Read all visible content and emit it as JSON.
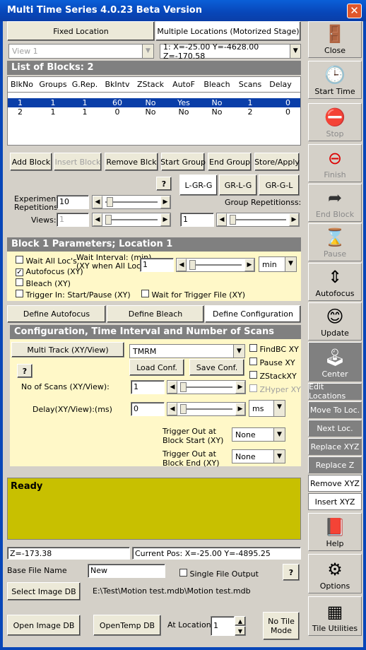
{
  "window": {
    "title": "Multi Time Series 4.0.23 Beta Version"
  },
  "location_tabs": {
    "fixed": "Fixed Location",
    "multiple": "Multiple Locations (Motorized Stage)"
  },
  "view_select": {
    "value": "View 1"
  },
  "location_select": {
    "value": "1: X=-25.00 Y=-4628.00 Z=-170.58"
  },
  "blocks": {
    "header": "List of Blocks: 2",
    "columns": [
      "BlkNo",
      "Groups",
      "G.Rep.",
      "BkIntv",
      "ZStack",
      "AutoF",
      "Bleach",
      "Scans",
      "Delay"
    ],
    "rows": [
      [
        "1",
        "1",
        "1",
        "60",
        "No",
        "Yes",
        "No",
        "1",
        "0"
      ],
      [
        "2",
        "1",
        "1",
        "0",
        "No",
        "No",
        "No",
        "2",
        "0"
      ]
    ],
    "buttons": {
      "add": "Add Block",
      "insert": "Insert Block",
      "remove": "Remove Blck",
      "start_group": "Start Group",
      "end_group": "End Group",
      "store": "Store/Apply"
    }
  },
  "repetitions": {
    "help": "?",
    "order_buttons": [
      "L-GR-G",
      "GR-L-G",
      "GR-G-L"
    ],
    "experiment_label": "Experiment\nRepetitions",
    "experiment_value": "10",
    "views_label": "Views:",
    "views_value": "1",
    "group_label": "Group Repetitionss:",
    "group_value": "1"
  },
  "block_params": {
    "header": "Block 1 Parameters; Location 1",
    "wait_all": "Wait All Loc's",
    "wait_interval_label": "Wait Interval: (min)\n(XY when All Loc)",
    "wait_interval_value": "1",
    "wait_unit": "min",
    "autofocus": "Autofocus (XY)",
    "bleach": "Bleach (XY)",
    "trigger_in": "Trigger In: Start/Pause (XY)",
    "wait_trigger": "Wait for Trigger File (XY)",
    "tabs": [
      "Define Autofocus",
      "Define Bleach",
      "Define Configuration"
    ]
  },
  "config": {
    "header": "Configuration, Time Interval and Number of Scans",
    "multi_track": "Multi Track (XY/View)",
    "config_value": "TMRM",
    "load": "Load Conf.",
    "save": "Save Conf.",
    "help": "?",
    "findbc": "FindBC XY",
    "pause": "Pause XY",
    "zstack": "ZStackXY",
    "zhyper": "ZHyper XY",
    "scans_label": "No of Scans (XY/View):",
    "scans_value": "1",
    "delay_label": "Delay(XY/View):(ms)",
    "delay_value": "0",
    "delay_unit": "ms",
    "trig_start_label": "Trigger Out at\nBlock Start (XY)",
    "trig_start_value": "None",
    "trig_end_label": "Trigger Out at\nBlock End (XY)",
    "trig_end_value": "None"
  },
  "status": {
    "text": "Ready",
    "z": "Z=-173.38",
    "pos": "Current Pos: X=-25.00 Y=-4895.25"
  },
  "files": {
    "base_label": "Base File Name",
    "base_value": "New",
    "single_output": "Single File Output",
    "help": "?",
    "select_db": "Select Image DB",
    "db_path": "E:\\Test\\Motion test.mdb\\Motion test.mdb",
    "open_db": "Open Image DB",
    "open_temp": "OpenTemp DB",
    "at_location_label": "At Location",
    "at_location_value": "1",
    "no_tile": "No Tile\nMode"
  },
  "sidebar": {
    "close": "Close",
    "start_time": "Start Time",
    "stop": "Stop",
    "finish": "Finish",
    "end_block": "End Block",
    "pause": "Pause",
    "autofocus": "Autofocus",
    "update": "Update",
    "center": "Center",
    "edit_locations": "Edit Locations",
    "move_to_loc": "Move To Loc.",
    "next_loc": "Next Loc.",
    "replace_xyz": "Replace XYZ",
    "replace_z": "Replace Z",
    "remove_xyz": "Remove XYZ",
    "insert_xyz": "Insert XYZ",
    "help": "Help",
    "options": "Options",
    "tile_utilities": "Tile Utilities"
  },
  "colors": {
    "title_blue": "#0846b8",
    "selection_blue": "#0a3ea8",
    "panel_yellow": "#fff8c8",
    "status_olive": "#c8c000",
    "dark_button": "#808080"
  }
}
